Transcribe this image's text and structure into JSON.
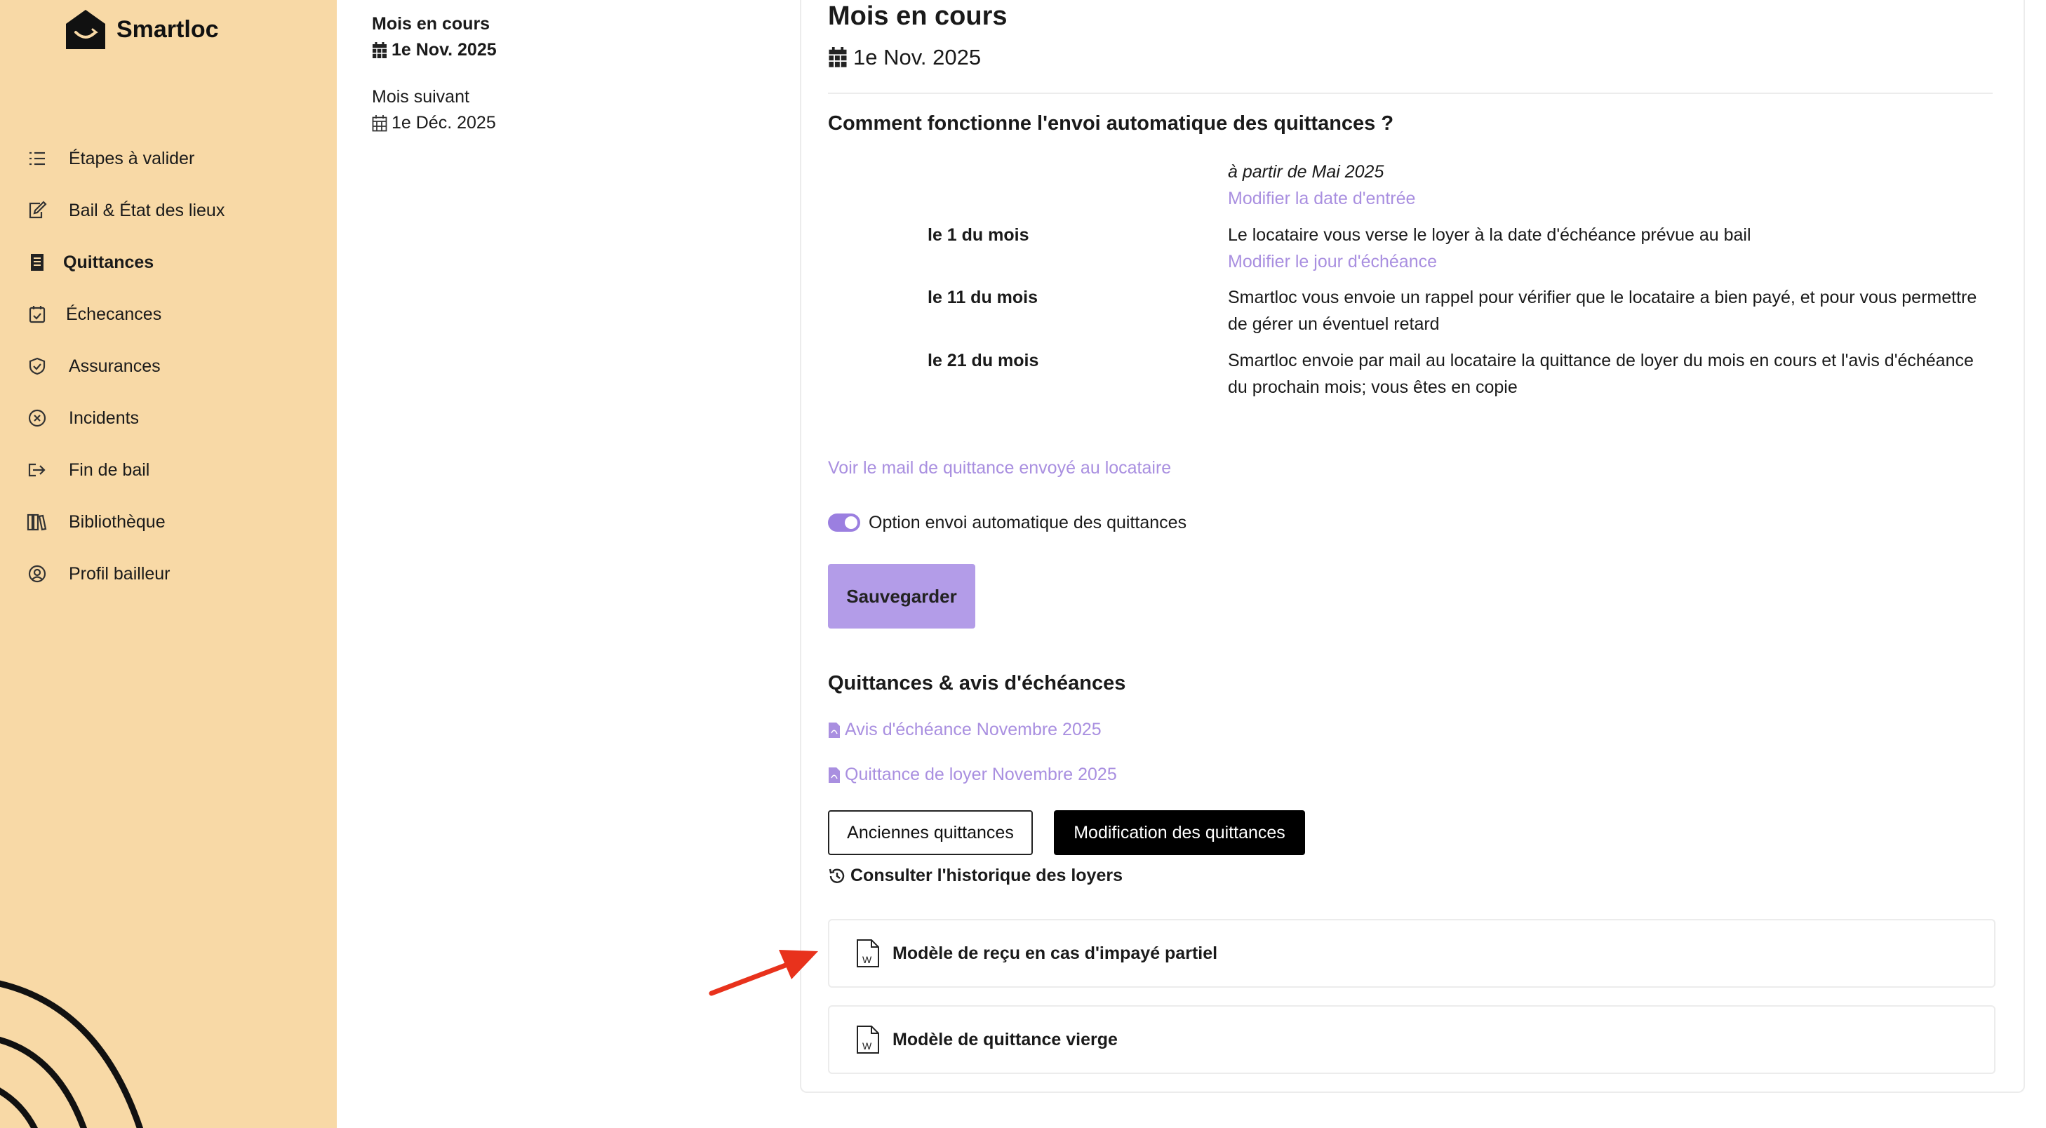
{
  "app": {
    "name": "Smartloc"
  },
  "sidebar": {
    "items": [
      {
        "label": "Étapes à valider",
        "icon": "checklist-icon"
      },
      {
        "label": "Bail & État des lieux",
        "icon": "edit-document-icon"
      },
      {
        "label": "Quittances",
        "icon": "receipt-icon",
        "active": true
      },
      {
        "label": "Échecances",
        "icon": "calendar-check-icon"
      },
      {
        "label": "Assurances",
        "icon": "shield-check-icon"
      },
      {
        "label": "Incidents",
        "icon": "circle-x-icon"
      },
      {
        "label": "Fin de bail",
        "icon": "exit-icon"
      },
      {
        "label": "Bibliothèque",
        "icon": "library-icon"
      },
      {
        "label": "Profil bailleur",
        "icon": "user-circle-icon"
      }
    ]
  },
  "months": {
    "current": {
      "title": "Mois en cours",
      "date": "1e Nov. 2025"
    },
    "next": {
      "title": "Mois suivant",
      "date": "1e Déc. 2025"
    }
  },
  "main": {
    "title": "Mois en cours",
    "date": "1e Nov. 2025",
    "how_title": "Comment fonctionne l'envoi automatique des quittances ?",
    "start_text": "à partir de Mai 2025",
    "start_link": "Modifier la date d'entrée",
    "steps": [
      {
        "when": "le 1 du mois",
        "text": "Le locataire vous verse le loyer à la date d'échéance prévue au bail",
        "link": "Modifier le jour d'échéance"
      },
      {
        "when": "le 11 du mois",
        "text_line1": "Smartloc vous envoie un rappel pour vérifier que le locataire a bien payé, et pour vous permettre",
        "text_line2": "de gérer un éventuel retard"
      },
      {
        "when": "le 21 du mois",
        "text_line1": "Smartloc envoie par mail au locataire la quittance de loyer du mois en cours et l'avis d'échéance",
        "text_line2": "du prochain mois; vous êtes en copie"
      }
    ],
    "mail_link": "Voir le mail de quittance envoyé au locataire",
    "toggle": {
      "label": "Option envoi automatique des quittances",
      "on": true
    },
    "save_label": "Sauvegarder",
    "docs_title": "Quittances & avis d'échéances",
    "docs": [
      {
        "label": "Avis d'échéance Novembre 2025"
      },
      {
        "label": "Quittance de loyer Novembre 2025"
      }
    ],
    "btn_old": "Anciennes quittances",
    "btn_modify": "Modification des quittances",
    "history_label": "Consulter l'historique des loyers",
    "cards": [
      {
        "label": "Modèle de reçu en cas d'impayé partiel"
      },
      {
        "label": "Modèle de quittance vierge"
      }
    ]
  },
  "colors": {
    "sidebar_bg": "#f8d9a6",
    "accent": "#a98fe0",
    "annotation_arrow": "#e8321c"
  }
}
